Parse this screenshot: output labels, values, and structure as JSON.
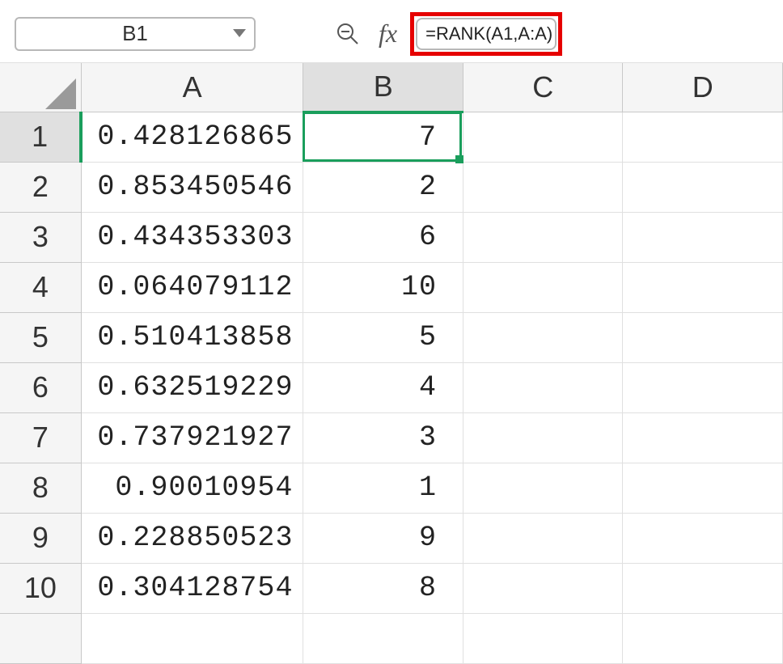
{
  "toolbar": {
    "name_box_value": "B1",
    "formula_bar_value": "=RANK(A1,A:A)",
    "fx_label": "fx"
  },
  "columns": [
    "A",
    "B",
    "C",
    "D"
  ],
  "rows": [
    {
      "n": "1",
      "a": "0.428126865",
      "b": "7"
    },
    {
      "n": "2",
      "a": "0.853450546",
      "b": "2"
    },
    {
      "n": "3",
      "a": "0.434353303",
      "b": "6"
    },
    {
      "n": "4",
      "a": "0.064079112",
      "b": "10"
    },
    {
      "n": "5",
      "a": "0.510413858",
      "b": "5"
    },
    {
      "n": "6",
      "a": "0.632519229",
      "b": "4"
    },
    {
      "n": "7",
      "a": "0.737921927",
      "b": "3"
    },
    {
      "n": "8",
      "a": "0.90010954",
      "b": "1"
    },
    {
      "n": "9",
      "a": "0.228850523",
      "b": "9"
    },
    {
      "n": "10",
      "a": "0.304128754",
      "b": "8"
    }
  ],
  "active_cell": "B1"
}
